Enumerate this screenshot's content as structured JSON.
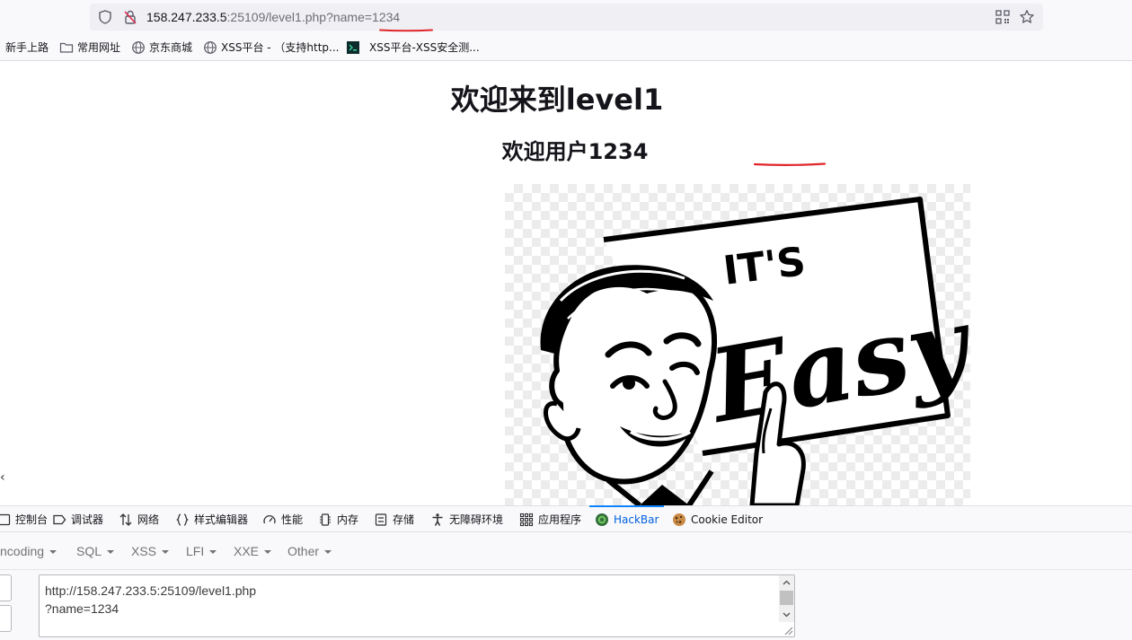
{
  "browser": {
    "url_host": "158.247.233.5",
    "url_rest": ":25109/level1.php?name=1234",
    "url_full_display": "158.247.233.5:25109/level1.php?name=1234",
    "underline_color": "#e0262b"
  },
  "bookmarks": [
    {
      "label": "新手上路",
      "icon": "none"
    },
    {
      "label": "常用网址",
      "icon": "folder-icon"
    },
    {
      "label": "京东商城",
      "icon": "globe-icon"
    },
    {
      "label": "XSS平台 - （支持http...",
      "icon": "globe-icon"
    },
    {
      "label": "XSS平台-XSS安全测...",
      "icon": "terminal-icon"
    }
  ],
  "page": {
    "heading": "欢迎来到level1",
    "welcome_prefix": "欢迎用户",
    "welcome_name": "1234",
    "hero_image_text": "IT'S Easy"
  },
  "devtools": {
    "tabs": [
      {
        "label": "控制台",
        "icon": "console-icon"
      },
      {
        "label": "调试器",
        "icon": "debugger-icon"
      },
      {
        "label": "网络",
        "icon": "network-icon"
      },
      {
        "label": "样式编辑器",
        "icon": "braces-icon"
      },
      {
        "label": "性能",
        "icon": "performance-icon"
      },
      {
        "label": "内存",
        "icon": "memory-icon"
      },
      {
        "label": "存储",
        "icon": "storage-icon"
      },
      {
        "label": "无障碍环境",
        "icon": "accessibility-icon"
      },
      {
        "label": "应用程序",
        "icon": "application-icon"
      },
      {
        "label": "HackBar",
        "icon": "hackbar-icon",
        "active": true
      },
      {
        "label": "Cookie Editor",
        "icon": "cookie-icon"
      }
    ],
    "accent_color": "#0a84ff"
  },
  "hackbar": {
    "menu": [
      "ncoding",
      "SQL",
      "XSS",
      "LFI",
      "XXE",
      "Other"
    ],
    "url_value": "http://158.247.233.5:25109/level1.php\n?name=1234"
  }
}
